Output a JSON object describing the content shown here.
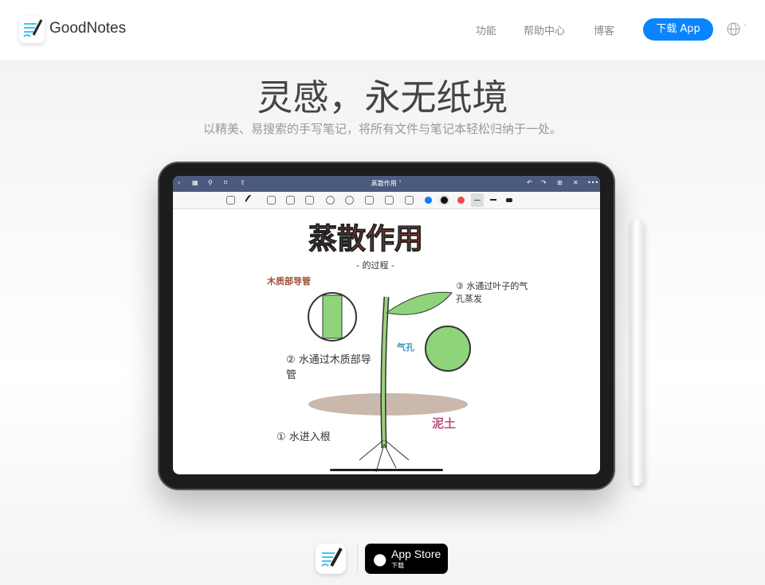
{
  "nav": {
    "brand": "GoodNotes",
    "links": [
      "功能",
      "帮助中心",
      "博客"
    ],
    "download": "下载 App",
    "language_icon": "globe-icon"
  },
  "hero": {
    "title": "灵感，永无纸境",
    "subtitle": "以精美、易搜索的手写笔记，将所有文件与笔记本轻松归纳于一处。"
  },
  "app": {
    "doc_title": "蒸散作用 ˅",
    "colors": [
      "#0a7cff",
      "#111111",
      "#f04848"
    ],
    "note": {
      "title": "蒸散作用",
      "subtitle": "- 的过程 -",
      "labels": [
        "木质部导管",
        "③ 水通过叶子的气孔蒸发",
        "气孔",
        "② 水通过木质部导管",
        "泥土",
        "① 水进入根"
      ]
    }
  },
  "store": {
    "title": "App Store",
    "sub": "下载"
  },
  "colors": {
    "accent": "#0a84ff",
    "toolbar": "#4b5a7e"
  }
}
